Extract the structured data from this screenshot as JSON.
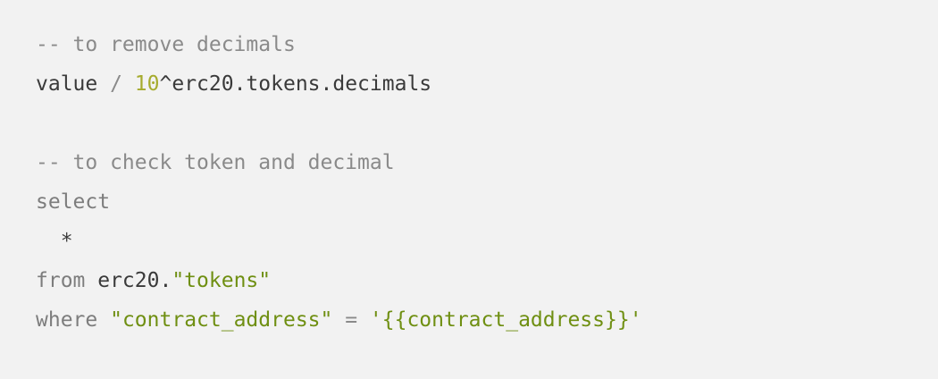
{
  "code": {
    "line1": {
      "comment": "-- to remove decimals"
    },
    "line2": {
      "ident": "value",
      "op": " / ",
      "number": "10",
      "rest": "^erc20.tokens.decimals"
    },
    "line4": {
      "comment": "-- to check token and decimal"
    },
    "line5": {
      "keyword": "select"
    },
    "line6": {
      "star": "  *"
    },
    "line7": {
      "keyword": "from",
      "ident": " erc20.",
      "string": "\"tokens\""
    },
    "line8": {
      "keyword": "where",
      "space": " ",
      "string": "\"contract_address\"",
      "op": " = ",
      "string2": "'{{contract_address}}'"
    }
  },
  "colors": {
    "background": "#f2f2f2",
    "comment": "#8a8a8a",
    "keyword": "#7d7d7d",
    "text": "#3a3a3a",
    "number": "#a6ab2e",
    "string": "#6f8f12"
  }
}
